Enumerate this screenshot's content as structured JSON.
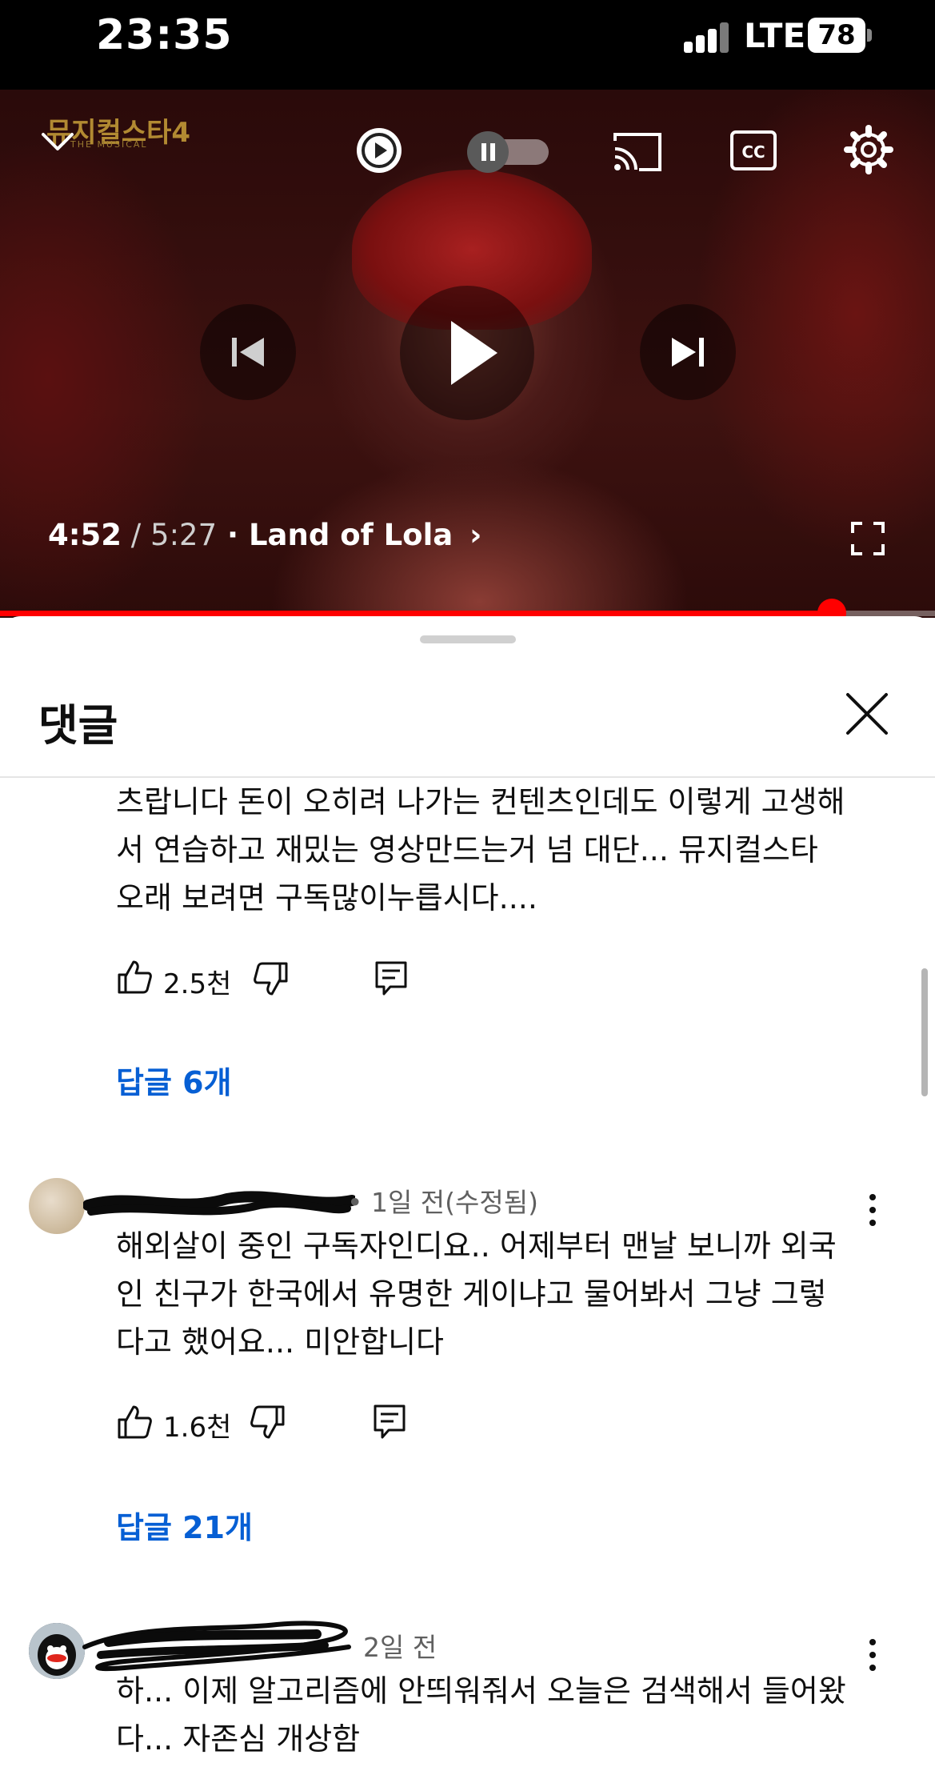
{
  "status_bar": {
    "time": "23:35",
    "network": "LTE",
    "battery": "78"
  },
  "player": {
    "brand_logo": "뮤지컬스타4",
    "brand_sub": "THE MUSICAL",
    "current_time": "4:52",
    "separator": " / ",
    "duration": "5:27",
    "chapter": " · Land of Lola",
    "chapter_chevron": "›",
    "progress_fraction": 0.89,
    "buffered_fraction": 0.31,
    "accent_color": "#ff0000",
    "icons": [
      "chevron-down-icon",
      "autoplay-icon",
      "pause-toggle-icon",
      "cast-icon",
      "captions-icon",
      "settings-gear-icon",
      "previous-icon",
      "play-icon",
      "next-icon",
      "fullscreen-icon"
    ]
  },
  "comments_panel": {
    "title": "댓글",
    "comments": [
      {
        "text": "츠랍니다 돈이 오히려 나가는 컨텐츠인데도 이렇게 고생해\n서 연습하고 재밌는 영상만드는거 넘 대단... 뮤지컬스타\n오래 보려면 구독많이누릅시다....",
        "likes": "2.5천",
        "replies": "답글 6개"
      },
      {
        "time": "• 1일 전(수정됨)",
        "text": "해외살이 중인 구독자인디요.. 어제부터 맨날 보니까 외국\n인 친구가 한국에서 유명한 게이냐고 물어봐서 그냥 그렇\n다고 했어요... 미안합니다",
        "likes": "1.6천",
        "replies": "답글 21개"
      },
      {
        "time": "2일 전",
        "text": "하... 이제 알고리즘에 안띄워줘서 오늘은 검색해서 들어왔\n다... 자존심 개상함"
      }
    ]
  }
}
